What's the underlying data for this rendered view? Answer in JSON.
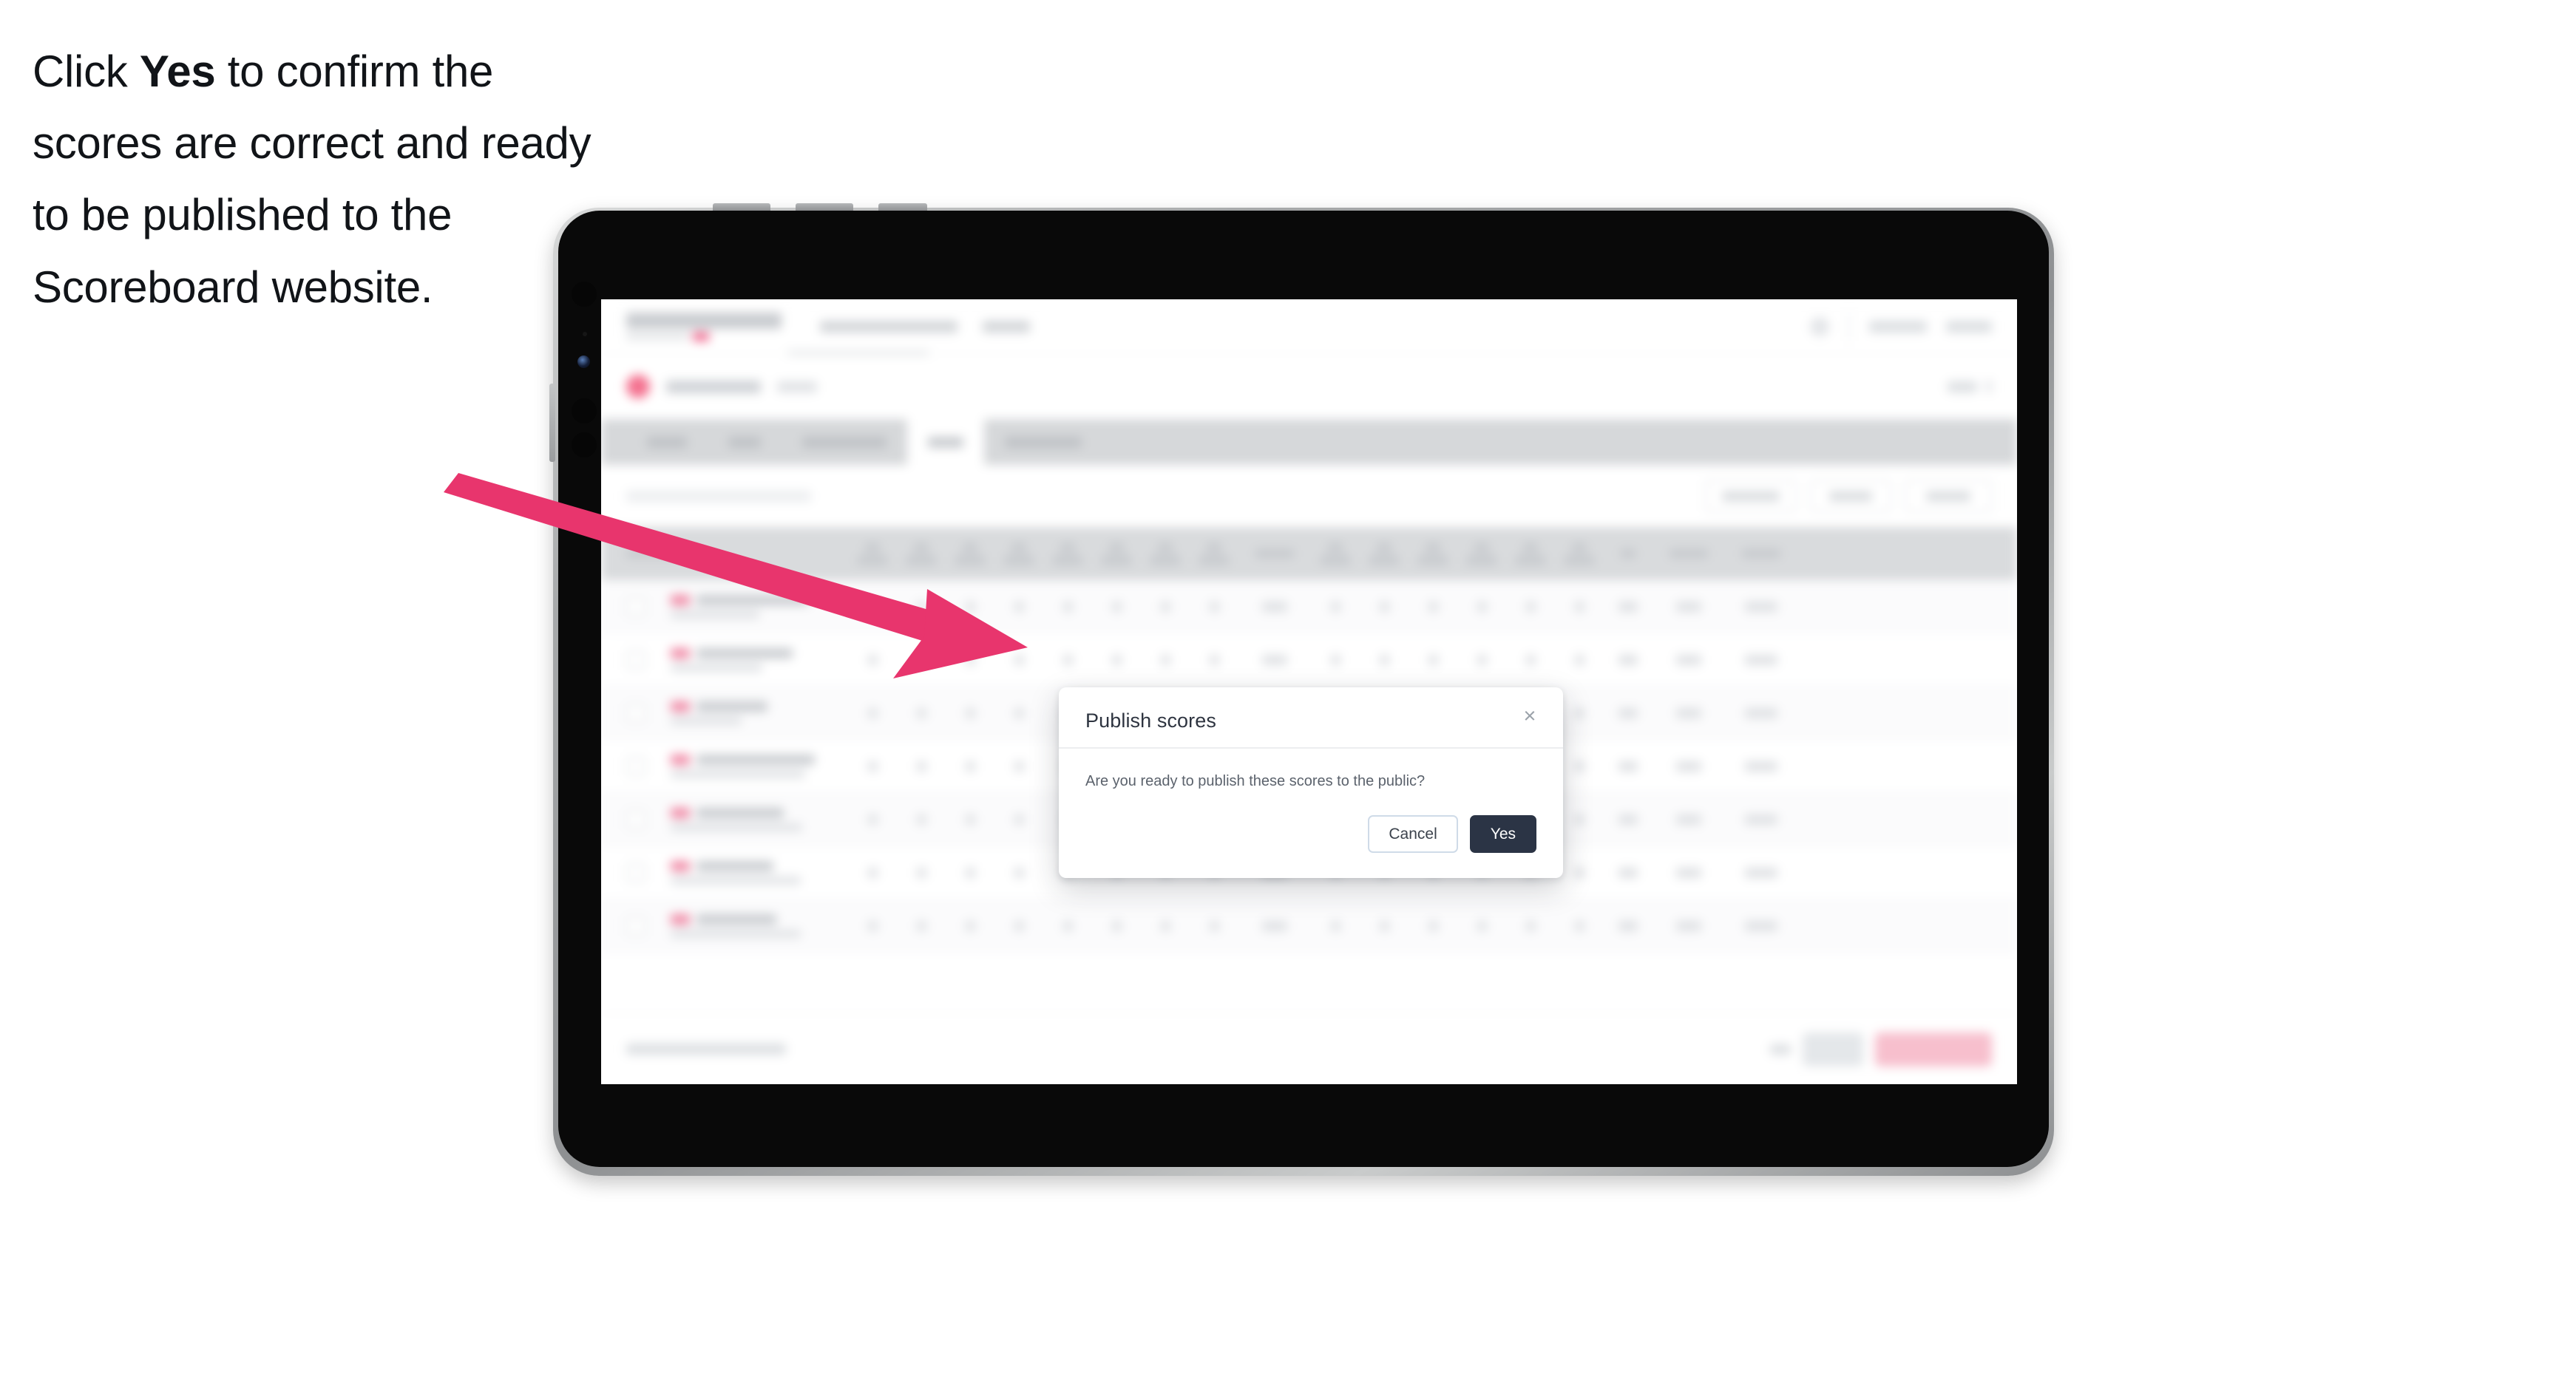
{
  "caption": {
    "lead": "Click ",
    "emphasis": "Yes",
    "rest": " to confirm the scores are correct and ready to be published to the Scoreboard website."
  },
  "modal": {
    "title": "Publish scores",
    "message": "Are you ready to publish these scores to the public?",
    "close_icon": "close-icon",
    "close_glyph": "×",
    "cancel_label": "Cancel",
    "confirm_label": "Yes"
  },
  "colors": {
    "arrow": "#e8356d",
    "confirm_button": "#2b3445",
    "cancel_border": "#cfdbe8",
    "brand_pink": "#ef5d86",
    "tab_strip": "#d6d8da",
    "table_header": "#d9dbdd",
    "device_body": "#090909",
    "device_rim": "#a7a9aa"
  },
  "device": {
    "type": "tablet",
    "orientation": "landscape"
  },
  "background_app": {
    "name": "Scoreboard",
    "state": "blurred",
    "tab_strip_tab_count": 5,
    "tab_strip_active_index": 3,
    "filter_control_count": 3,
    "table_row_count": 7,
    "score_column_count": 16
  }
}
